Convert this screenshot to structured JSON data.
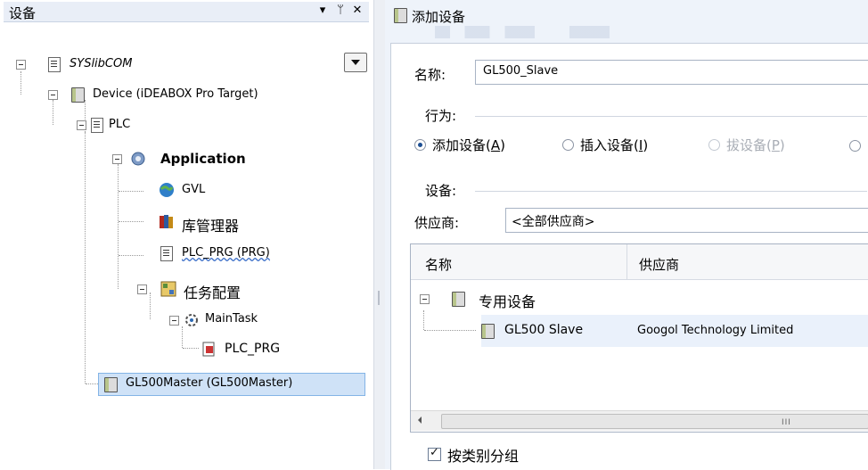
{
  "left_pane": {
    "title": "设备",
    "header_buttons": {
      "dropdown": "▾",
      "pin": "ᛘ",
      "close": "✕"
    },
    "tree": {
      "root": "SYSlibCOM",
      "device": "Device (iDEABOX Pro Target)",
      "plc": "PLC",
      "application": "Application",
      "gvl": "GVL",
      "library_manager": "库管理器",
      "plc_prg": "PLC_PRG (PRG)",
      "task_config": "任务配置",
      "main_task": "MainTask",
      "main_task_plc_prg": "PLC_PRG",
      "gl500_master": "GL500Master (GL500Master)"
    }
  },
  "right_pane": {
    "title": "添加设备",
    "name_label": "名称:",
    "name_value": "GL500_Slave",
    "action_label": "行为:",
    "actions": [
      {
        "label": "添加设备",
        "key": "A",
        "checked": true,
        "enabled": true
      },
      {
        "label": "插入设备",
        "key": "I",
        "checked": false,
        "enabled": true
      },
      {
        "label": "拔设备",
        "key": "P",
        "checked": false,
        "enabled": false
      }
    ],
    "device_label": "设备:",
    "vendor_label": "供应商:",
    "vendor_value": "<全部供应商>",
    "list": {
      "col_name": "名称",
      "col_vendor": "供应商",
      "group": "专用设备",
      "item_name": "GL500 Slave",
      "item_vendor": "Googol Technology Limited"
    },
    "scroll_grip": "III",
    "group_by_category_label": "按类别分组",
    "group_by_category_checked": true
  },
  "colors": {
    "accent": "#1d4f93",
    "selection": "#cfe2f7",
    "pane_bg": "#eef3fa"
  },
  "icons": {
    "root": "project-icon",
    "device": "device-icon",
    "plc": "plc-logic-icon",
    "application": "application-gear-icon",
    "gvl": "globe-icon",
    "library": "books-icon",
    "pou": "document-icon",
    "task_config": "task-config-icon",
    "task": "task-icon",
    "program_call": "program-call-icon"
  }
}
